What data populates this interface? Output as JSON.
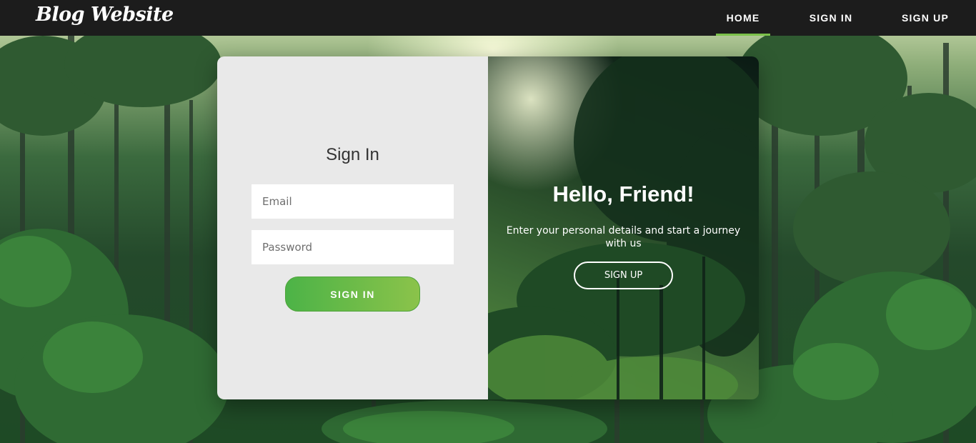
{
  "navbar": {
    "logo": "Blog Website",
    "links": [
      "HOME",
      "SIGN IN",
      "SIGN UP"
    ],
    "active_link": "HOME",
    "active_color": "#7bc14a"
  },
  "signin_form": {
    "title": "Sign In",
    "email_placeholder": "Email",
    "password_placeholder": "Password",
    "submit_label": "SIGN IN",
    "button_gradient": [
      "#4cb347",
      "#8bc34a"
    ]
  },
  "welcome_panel": {
    "title": "Hello, Friend!",
    "text": "Enter your personal details and start a journey with us",
    "button_label": "SIGN UP"
  },
  "background": {
    "description_icon": "forest-background-image"
  }
}
